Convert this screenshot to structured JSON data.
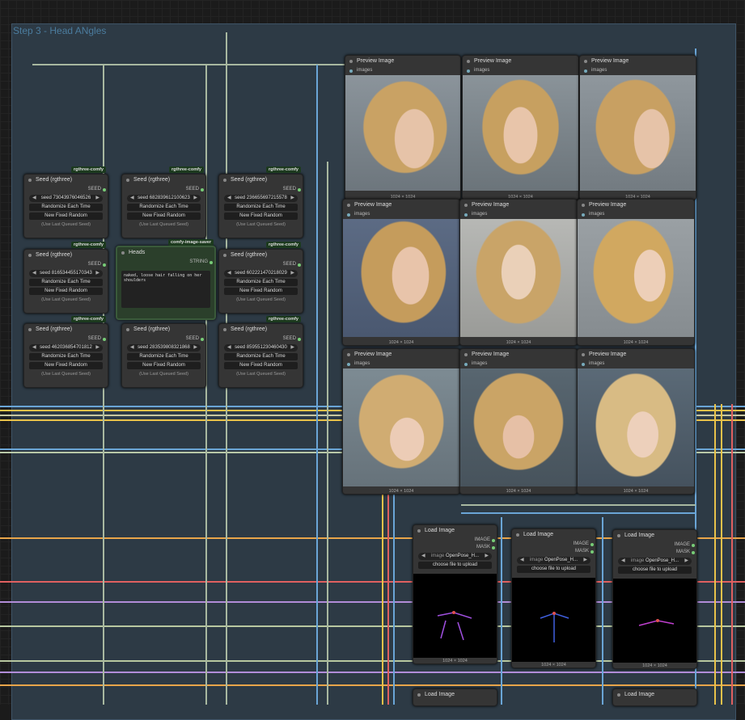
{
  "group_title": "Step 3 - Head ANgles",
  "seed_nodes": [
    {
      "title": "Seed (rgthree)",
      "tag": "rgthree-comfy",
      "output": "SEED",
      "seed": "73043976046526"
    },
    {
      "title": "Seed (rgthree)",
      "tag": "rgthree-comfy",
      "output": "SEED",
      "seed": "682839612100623"
    },
    {
      "title": "Seed (rgthree)",
      "tag": "rgthree-comfy",
      "output": "SEED",
      "seed": "236655697215578"
    },
    {
      "title": "Seed (rgthree)",
      "tag": "rgthree-comfy",
      "output": "SEED",
      "seed": "816534455170343"
    },
    {
      "title": "Seed (rgthree)",
      "tag": "rgthree-comfy",
      "output": "SEED",
      "seed": "602221470218029"
    },
    {
      "title": "Seed (rgthree)",
      "tag": "rgthree-comfy",
      "output": "SEED",
      "seed": "462036854701812"
    },
    {
      "title": "Seed (rgthree)",
      "tag": "rgthree-comfy",
      "output": "SEED",
      "seed": "283539808321868"
    },
    {
      "title": "Seed (rgthree)",
      "tag": "rgthree-comfy",
      "output": "SEED",
      "seed": "859551230460430"
    }
  ],
  "seed_widget": {
    "label": "seed",
    "randomize": "Randomize Each Time",
    "new_fixed": "New Fixed Random",
    "use_last": "(Use Last Queued Seed)"
  },
  "heads_node": {
    "title": "Heads",
    "tag": "comfy-image-saver",
    "output": "STRING",
    "text": "naked, loose hair falling on her shoulders"
  },
  "preview_nodes": [
    {
      "title": "Preview Image",
      "input": "images",
      "size": "1024 × 1024"
    },
    {
      "title": "Preview Image",
      "input": "images",
      "size": "1024 × 1024"
    },
    {
      "title": "Preview Image",
      "input": "images",
      "size": "1024 × 1024"
    },
    {
      "title": "Preview Image",
      "input": "images",
      "size": "1024 × 1024"
    },
    {
      "title": "Preview Image",
      "input": "images",
      "size": "1024 × 1024"
    },
    {
      "title": "Preview Image",
      "input": "images",
      "size": "1024 × 1024"
    },
    {
      "title": "Preview Image",
      "input": "images",
      "size": "1024 × 1024"
    },
    {
      "title": "Preview Image",
      "input": "images",
      "size": "1024 × 1024"
    },
    {
      "title": "Preview Image",
      "input": "images",
      "size": "1024 × 1024"
    }
  ],
  "load_nodes": [
    {
      "title": "Load Image",
      "out1": "IMAGE",
      "out2": "MASK",
      "image_label": "image",
      "image_value": "OpenPose_H...",
      "upload": "choose file to upload",
      "size": "1024 × 1024"
    },
    {
      "title": "Load Image",
      "out1": "IMAGE",
      "out2": "MASK",
      "image_label": "image",
      "image_value": "OpenPose_H...",
      "upload": "choose file to upload",
      "size": "1024 × 1024"
    },
    {
      "title": "Load Image",
      "out1": "IMAGE",
      "out2": "MASK",
      "image_label": "image",
      "image_value": "OpenPose_H...",
      "upload": "choose file to upload",
      "size": "1024 × 1024"
    },
    {
      "title": "Load Image"
    },
    {
      "title": "Load Image"
    }
  ],
  "colors": {
    "background": "#1b1b1b",
    "group": "#2d3a45",
    "node": "#353535",
    "heads_node": "#2b3f2b",
    "tag": "#1c3a1e"
  }
}
